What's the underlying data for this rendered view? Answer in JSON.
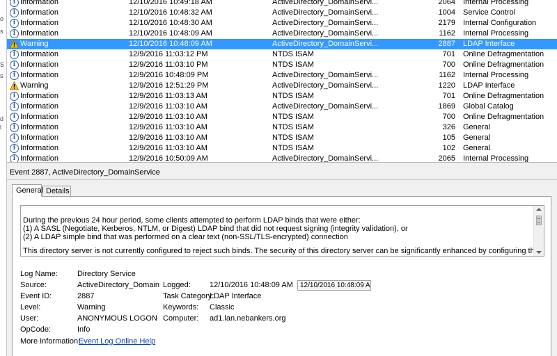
{
  "colors": {
    "selection": "#3399ff",
    "info_icon": "#2f5da5",
    "warning_icon": "#f2c511"
  },
  "events": [
    {
      "level": "Information",
      "icon": "info-icon",
      "datetime": "12/10/2016 10:49:18 AM",
      "source": "ActiveDirectory_DomainServi...",
      "event_id": "2064",
      "task": "Internal Processing",
      "selected": false
    },
    {
      "level": "Information",
      "icon": "info-icon",
      "datetime": "12/10/2016 10:48:32 AM",
      "source": "ActiveDirectory_DomainServi...",
      "event_id": "1004",
      "task": "Service Control",
      "selected": false
    },
    {
      "level": "Information",
      "icon": "info-icon",
      "datetime": "12/10/2016 10:48:30 AM",
      "source": "ActiveDirectory_DomainServi...",
      "event_id": "2179",
      "task": "Internal Configuration",
      "selected": false
    },
    {
      "level": "Information",
      "icon": "info-icon",
      "datetime": "12/10/2016 10:48:09 AM",
      "source": "ActiveDirectory_DomainServi...",
      "event_id": "1162",
      "task": "Internal Processing",
      "selected": false
    },
    {
      "level": "Warning",
      "icon": "warning-icon",
      "datetime": "12/10/2016 10:48:09 AM",
      "source": "ActiveDirectory_DomainServi...",
      "event_id": "2887",
      "task": "LDAP Interface",
      "selected": true
    },
    {
      "level": "Information",
      "icon": "info-icon",
      "datetime": "12/9/2016 11:03:12 PM",
      "source": "NTDS ISAM",
      "event_id": "701",
      "task": "Online Defragmentation",
      "selected": false
    },
    {
      "level": "Information",
      "icon": "info-icon",
      "datetime": "12/9/2016 11:03:10 PM",
      "source": "NTDS ISAM",
      "event_id": "700",
      "task": "Online Defragmentation",
      "selected": false
    },
    {
      "level": "Information",
      "icon": "info-icon",
      "datetime": "12/9/2016 10:48:09 PM",
      "source": "ActiveDirectory_DomainServi...",
      "event_id": "1162",
      "task": "Internal Processing",
      "selected": false
    },
    {
      "level": "Warning",
      "icon": "warning-icon",
      "datetime": "12/9/2016 12:51:29 PM",
      "source": "ActiveDirectory_DomainServi...",
      "event_id": "1220",
      "task": "LDAP Interface",
      "selected": false
    },
    {
      "level": "Information",
      "icon": "info-icon",
      "datetime": "12/9/2016 11:03:13 AM",
      "source": "NTDS ISAM",
      "event_id": "701",
      "task": "Online Defragmentation",
      "selected": false
    },
    {
      "level": "Information",
      "icon": "info-icon",
      "datetime": "12/9/2016 11:03:10 AM",
      "source": "ActiveDirectory_DomainServi...",
      "event_id": "1869",
      "task": "Global Catalog",
      "selected": false
    },
    {
      "level": "Information",
      "icon": "info-icon",
      "datetime": "12/9/2016 11:03:10 AM",
      "source": "NTDS ISAM",
      "event_id": "700",
      "task": "Online Defragmentation",
      "selected": false
    },
    {
      "level": "Information",
      "icon": "info-icon",
      "datetime": "12/9/2016 11:03:10 AM",
      "source": "NTDS ISAM",
      "event_id": "326",
      "task": "General",
      "selected": false
    },
    {
      "level": "Information",
      "icon": "info-icon",
      "datetime": "12/9/2016 11:03:10 AM",
      "source": "NTDS ISAM",
      "event_id": "105",
      "task": "General",
      "selected": false
    },
    {
      "level": "Information",
      "icon": "info-icon",
      "datetime": "12/9/2016 11:03:10 AM",
      "source": "NTDS ISAM",
      "event_id": "102",
      "task": "General",
      "selected": false
    },
    {
      "level": "Information",
      "icon": "info-icon",
      "datetime": "12/9/2016 10:50:09 AM",
      "source": "ActiveDirectory_DomainServi...",
      "event_id": "2065",
      "task": "Internal Processing",
      "selected": false
    }
  ],
  "detail": {
    "title": "Event 2887, ActiveDirectory_DomainService",
    "tabs": [
      "General",
      "Details"
    ],
    "description": [
      "During the previous 24 hour period, some clients attempted to perform LDAP binds that were either:",
      "(1) A SASL (Negotiate, Kerberos, NTLM, or Digest) LDAP bind that did not request signing (integrity validation), or",
      "(2) A LDAP simple bind that was performed on a clear text (non-SSL/TLS-encrypted) connection",
      "This directory server is not currently configured to reject such binds.  The security of this directory server can be significantly enhanced by configuring the server to reject such"
    ],
    "properties": {
      "log_name_label": "Log Name:",
      "log_name": "Directory Service",
      "source_label": "Source:",
      "source": "ActiveDirectory_DomainServ",
      "logged_label": "Logged:",
      "logged": "12/10/2016 10:48:09 AM",
      "logged_box": "12/10/2016 10:48:09 AM",
      "event_id_label": "Event ID:",
      "event_id": "2887",
      "task_category_label": "Task Category:",
      "task_category": "LDAP Interface",
      "level_label": "Level:",
      "level": "Warning",
      "keywords_label": "Keywords:",
      "keywords": "Classic",
      "user_label": "User:",
      "user": "ANONYMOUS LOGON",
      "computer_label": "Computer:",
      "computer": "ad1.lan.nebankers.org",
      "opcode_label": "OpCode:",
      "opcode": "Info",
      "more_info_label": "More Information:",
      "more_info_link": "Event Log Online Help"
    }
  },
  "left_strip": [
    "o",
    "s",
    "S",
    "s",
    "d",
    "l"
  ]
}
